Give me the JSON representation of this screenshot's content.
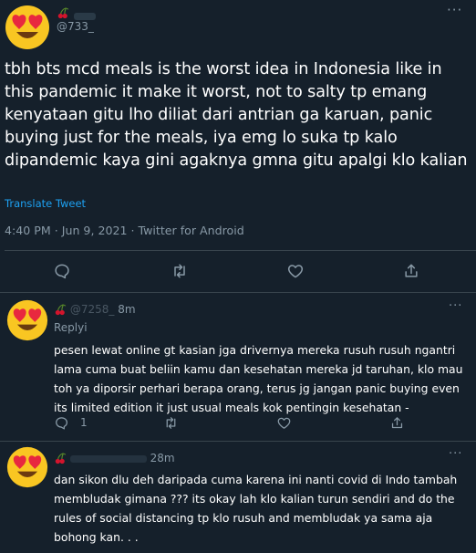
{
  "main_tweet": {
    "display_name": "",
    "handle": "@733_",
    "text": "tbh bts mcd meals is the worst idea in Indonesia like in this pandemic it make it worst, not to salty tp emang kenyataan gitu lho diliat dari antrian ga karuan, panic buying just for the meals, iya emg lo suka tp kalo dipandemic kaya gini agaknya gmna gitu apalgi klo kalian",
    "translate_label": "Translate Tweet",
    "meta": "4:40 PM · Jun 9, 2021 · Twitter for Android",
    "more_label": "···"
  },
  "replies": [
    {
      "handle": "@7258_",
      "time": "8m",
      "replying_label": "Replyi",
      "text": "pesen lewat online gt kasian jga drivernya mereka rusuh rusuh ngantri lama cuma buat beliin kamu dan kesehatan mereka jd taruhan, klo mau toh ya diporsir perhari berapa orang, terus jg jangan panic buying even its limited edition it just usual meals kok pentingin kesehatan -",
      "reply_count": "1",
      "more_label": "···"
    },
    {
      "handle": "",
      "time": "28m",
      "text": "dan sikon dlu deh daripada cuma karena ini nanti covid di Indo tambah membludak gimana ??? its okay lah klo kalian turun sendiri and do the rules of social distancing tp klo rusuh and membludak ya sama aja bohong kan. . .",
      "more_label": "···"
    }
  ],
  "colors": {
    "background": "#15202b",
    "text": "#ffffff",
    "muted": "#8899a6",
    "link": "#1da1f2",
    "divider": "#38444d"
  },
  "icons": [
    "heart-eyes-emoji-icon",
    "cherry-icon",
    "reply-icon",
    "retweet-icon",
    "like-icon",
    "share-icon",
    "more-icon"
  ]
}
